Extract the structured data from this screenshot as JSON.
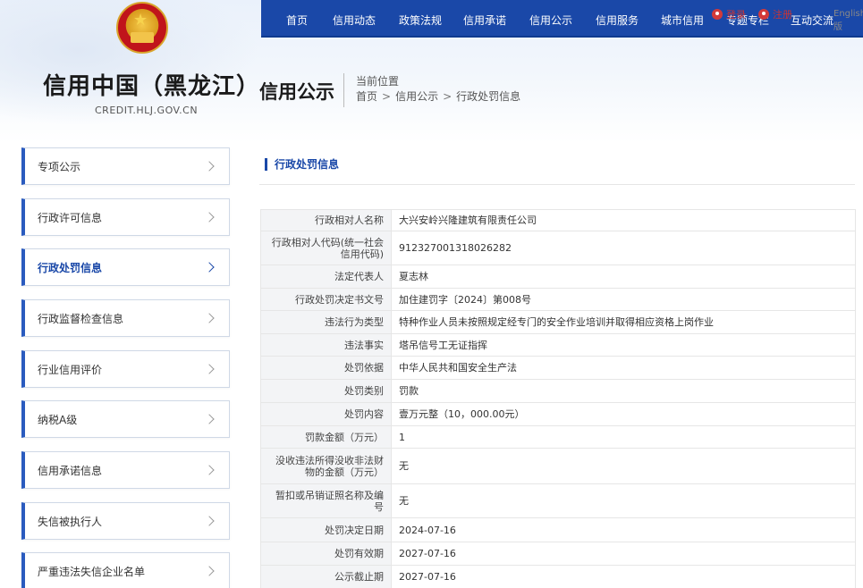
{
  "site": {
    "title": "信用中国（黑龙江）",
    "domain": "CREDIT.HLJ.GOV.CN"
  },
  "nav": {
    "items": [
      "首页",
      "信用动态",
      "政策法规",
      "信用承诺",
      "信用公示",
      "信用服务",
      "城市信用",
      "专题专栏",
      "互动交流"
    ],
    "login": "登录",
    "register": "注册",
    "language": "English版"
  },
  "page": {
    "section_title": "信用公示",
    "breadcrumb_label": "当前位置",
    "breadcrumb": [
      "首页",
      "信用公示",
      "行政处罚信息"
    ],
    "content_heading": "行政处罚信息"
  },
  "sidebar": {
    "items": [
      {
        "label": "专项公示"
      },
      {
        "label": "行政许可信息"
      },
      {
        "label": "行政处罚信息"
      },
      {
        "label": "行政监督检查信息"
      },
      {
        "label": "行业信用评价"
      },
      {
        "label": "纳税A级"
      },
      {
        "label": "信用承诺信息"
      },
      {
        "label": "失信被执行人"
      },
      {
        "label": "严重违法失信企业名单"
      }
    ],
    "active": "行政处罚信息"
  },
  "table": {
    "rows": [
      {
        "k": "行政相对人名称",
        "v": "大兴安岭兴隆建筑有限责任公司"
      },
      {
        "k": "行政相对人代码(统一社会信用代码)",
        "v": "912327001318026282"
      },
      {
        "k": "法定代表人",
        "v": "夏志林"
      },
      {
        "k": "行政处罚决定书文号",
        "v": "加住建罚字〔2024〕第008号"
      },
      {
        "k": "违法行为类型",
        "v": "特种作业人员未按照规定经专门的安全作业培训并取得相应资格上岗作业"
      },
      {
        "k": "违法事实",
        "v": "塔吊信号工无证指挥"
      },
      {
        "k": "处罚依据",
        "v": "中华人民共和国安全生产法"
      },
      {
        "k": "处罚类别",
        "v": "罚款"
      },
      {
        "k": "处罚内容",
        "v": "壹万元整（10，000.00元）"
      },
      {
        "k": "罚款金额（万元）",
        "v": "1"
      },
      {
        "k": "没收违法所得没收非法财物的金额（万元）",
        "v": "无"
      },
      {
        "k": "暂扣或吊销证照名称及编号",
        "v": "无"
      },
      {
        "k": "处罚决定日期",
        "v": "2024-07-16"
      },
      {
        "k": "处罚有效期",
        "v": "2027-07-16"
      },
      {
        "k": "公示截止期",
        "v": "2027-07-16"
      }
    ]
  }
}
